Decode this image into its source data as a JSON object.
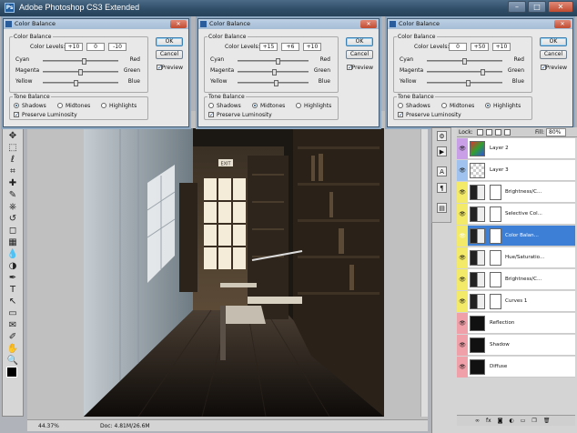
{
  "app": {
    "title": "Adobe Photoshop CS3 Extended",
    "icon_text": "Ps"
  },
  "window_controls": {
    "minimize": "–",
    "maximize": "□",
    "close": "✕"
  },
  "dialogs": [
    {
      "title": "Color Balance",
      "group_label": "Color Balance",
      "levels_label": "Color Levels:",
      "levels": [
        "+10",
        "0",
        "-10"
      ],
      "sliders": [
        {
          "left": "Cyan",
          "right": "Red",
          "value": 0.55
        },
        {
          "left": "Magenta",
          "right": "Green",
          "value": 0.5
        },
        {
          "left": "Yellow",
          "right": "Blue",
          "value": 0.45
        }
      ],
      "tone_label": "Tone Balance",
      "tones": [
        "Shadows",
        "Midtones",
        "Highlights"
      ],
      "selected_tone": 0,
      "preserve": "Preserve Luminosity",
      "ok": "OK",
      "cancel": "Cancel",
      "preview": "Preview"
    },
    {
      "title": "Color Balance",
      "group_label": "Color Balance",
      "levels_label": "Color Levels:",
      "levels": [
        "+15",
        "+6",
        "+10"
      ],
      "sliders": [
        {
          "left": "Cyan",
          "right": "Red",
          "value": 0.575
        },
        {
          "left": "Magenta",
          "right": "Green",
          "value": 0.53
        },
        {
          "left": "Yellow",
          "right": "Blue",
          "value": 0.55
        }
      ],
      "tone_label": "Tone Balance",
      "tones": [
        "Shadows",
        "Midtones",
        "Highlights"
      ],
      "selected_tone": 1,
      "preserve": "Preserve Luminosity",
      "ok": "OK",
      "cancel": "Cancel",
      "preview": "Preview"
    },
    {
      "title": "Color Balance",
      "group_label": "Color Balance",
      "levels_label": "Color Levels:",
      "levels": [
        "0",
        "+50",
        "+10"
      ],
      "sliders": [
        {
          "left": "Cyan",
          "right": "Red",
          "value": 0.5
        },
        {
          "left": "Magenta",
          "right": "Green",
          "value": 0.75
        },
        {
          "left": "Yellow",
          "right": "Blue",
          "value": 0.55
        }
      ],
      "tone_label": "Tone Balance",
      "tones": [
        "Shadows",
        "Midtones",
        "Highlights"
      ],
      "selected_tone": 2,
      "preserve": "Preserve Luminosity",
      "ok": "OK",
      "cancel": "Cancel",
      "preview": "Preview"
    }
  ],
  "status": {
    "zoom": "44.37%",
    "doc": "Doc: 4.81M/26.6M"
  },
  "layers_panel": {
    "lock_label": "Lock:",
    "fill_label": "Fill:",
    "fill_value": "80%",
    "layers": [
      {
        "name": "Layer 2",
        "eye_color": "#c9a0e8",
        "thumb": "layer2",
        "selected": false
      },
      {
        "name": "Layer 3",
        "eye_color": "#9fc3ee",
        "thumb": "layer3",
        "selected": false
      },
      {
        "name": "Brightness/C...",
        "eye_color": "#f3ea6a",
        "thumb": "adjust",
        "selected": false
      },
      {
        "name": "Selective Col...",
        "eye_color": "#f3ea6a",
        "thumb": "adjust",
        "selected": false
      },
      {
        "name": "Color Balan...",
        "eye_color": "#f3ea6a",
        "thumb": "adjust",
        "selected": true
      },
      {
        "name": "Hue/Saturatio...",
        "eye_color": "#f3ea6a",
        "thumb": "adjust",
        "selected": false
      },
      {
        "name": "Brightness/C...",
        "eye_color": "#f3ea6a",
        "thumb": "adjust",
        "selected": false
      },
      {
        "name": "Curves 1",
        "eye_color": "#f3ea6a",
        "thumb": "adjust",
        "selected": false
      },
      {
        "name": "Reflection",
        "eye_color": "#f0a0a8",
        "thumb": "dark",
        "selected": false
      },
      {
        "name": "Shadow",
        "eye_color": "#f0a0a8",
        "thumb": "dark",
        "selected": false
      },
      {
        "name": "Diffuse",
        "eye_color": "#f0a0a8",
        "thumb": "dark",
        "selected": false
      }
    ],
    "footer_icons": [
      "link-icon",
      "fx-icon",
      "mask-icon",
      "adjustment-icon",
      "folder-icon",
      "new-layer-icon",
      "trash-icon"
    ]
  },
  "tools": [
    "move-tool",
    "marquee-tool",
    "lasso-tool",
    "crop-tool",
    "heal-tool",
    "brush-tool",
    "stamp-tool",
    "history-brush-tool",
    "eraser-tool",
    "gradient-tool",
    "blur-tool",
    "dodge-tool",
    "pen-tool",
    "type-tool",
    "path-select-tool",
    "shape-tool",
    "notes-tool",
    "eyedropper-tool",
    "hand-tool",
    "zoom-tool"
  ],
  "canvas": {
    "exit_sign": "EXIT"
  }
}
